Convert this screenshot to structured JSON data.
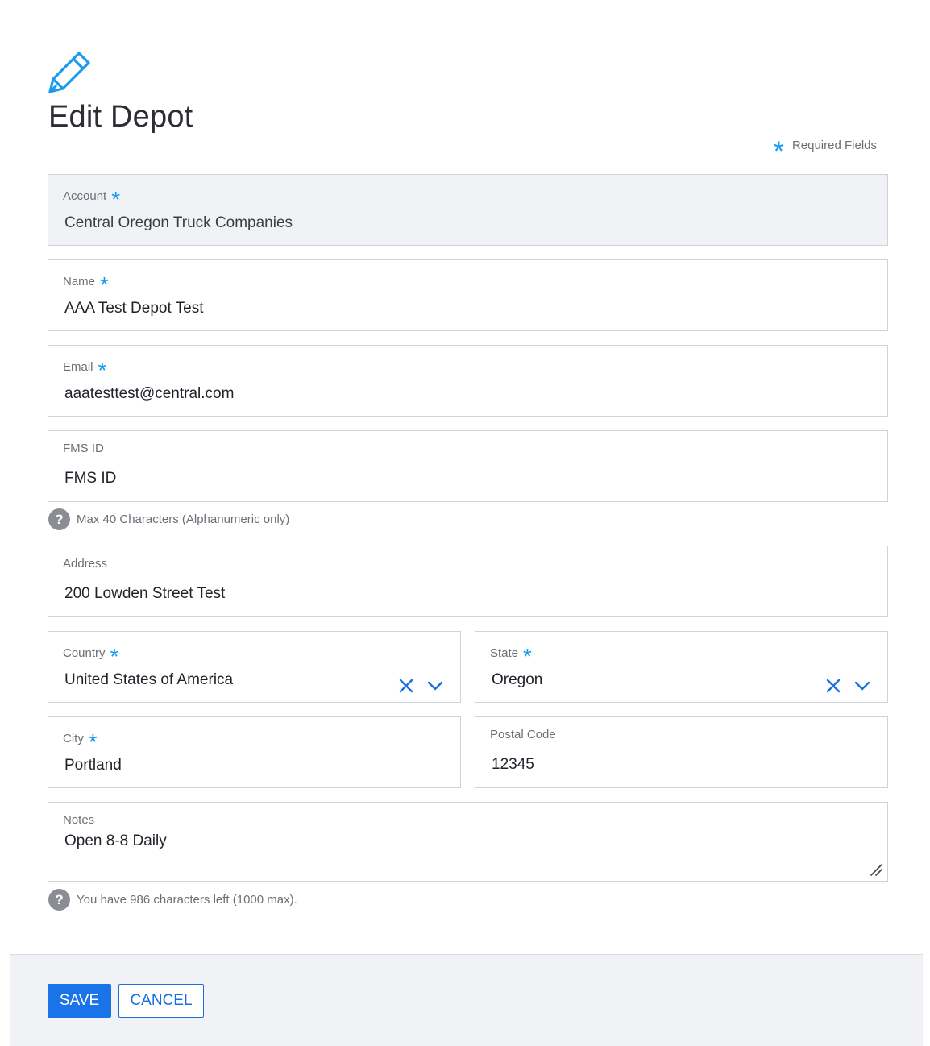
{
  "page": {
    "title": "Edit Depot",
    "required_note": "Required Fields",
    "required_marker": "*"
  },
  "fields": {
    "account": {
      "label": "Account",
      "value": "Central Oregon Truck Companies",
      "required": true
    },
    "name": {
      "label": "Name",
      "value": "AAA Test Depot Test",
      "required": true
    },
    "email": {
      "label": "Email",
      "value": "aaatesttest@central.com",
      "required": true
    },
    "fms_id": {
      "label": "FMS ID",
      "value": "FMS ID",
      "help": "Max 40 Characters (Alphanumeric only)"
    },
    "address": {
      "label": "Address",
      "value": "200 Lowden Street Test"
    },
    "country": {
      "label": "Country",
      "value": "United States of America",
      "required": true
    },
    "state": {
      "label": "State",
      "value": "Oregon",
      "required": true
    },
    "city": {
      "label": "City",
      "value": "Portland",
      "required": true
    },
    "postal_code": {
      "label": "Postal Code",
      "value": "12345"
    },
    "notes": {
      "label": "Notes",
      "value": "Open 8-8 Daily",
      "help": "You have 986 characters left (1000 max)."
    }
  },
  "actions": {
    "save_label": "SAVE",
    "cancel_label": "CANCEL"
  },
  "icons": {
    "edit": "pencil-icon",
    "help": "question-circle-icon",
    "clear": "close-icon",
    "dropdown": "chevron-down-icon",
    "resize": "resize-handle-icon"
  },
  "colors": {
    "accent": "#1a73e8",
    "required_star": "#1a9bf0",
    "readonly_bg": "#f1f2f5",
    "footer_bg": "#f1f2f5"
  }
}
